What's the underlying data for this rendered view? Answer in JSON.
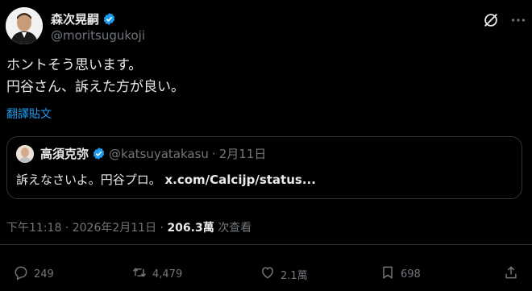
{
  "author": {
    "display_name": "森次晃嗣",
    "handle": "@moritsugukoji"
  },
  "icons": {
    "verified": "verified-badge-icon",
    "grok": "grok-icon",
    "more": "more-icon",
    "reply": "reply-icon",
    "retweet": "retweet-icon",
    "like": "heart-icon",
    "bookmark": "bookmark-icon",
    "share": "share-icon"
  },
  "colors": {
    "background": "#000000",
    "text": "#e7e9ea",
    "muted": "#71767b",
    "accent": "#1d9bf0",
    "border": "#2f3336"
  },
  "body": {
    "line1": "ホントそう思います。",
    "line2": "円谷さん、訴えた方が良い。"
  },
  "translate_label": "翻譯貼文",
  "quote": {
    "display_name": "高須克弥",
    "handle": "@katsuyatakasu",
    "separator": "·",
    "date": "2月11日",
    "text": "訴えなさいよ。円谷プロ。",
    "link": "x.com/Calcijp/status..."
  },
  "meta": {
    "time": "下午11:18",
    "separator": "·",
    "date": "2026年2月11日",
    "separator2": "·",
    "views_count": "206.3萬",
    "views_label": "次查看"
  },
  "actions": {
    "replies": "249",
    "retweets": "4,479",
    "likes": "2.1萬",
    "bookmarks": "698"
  }
}
